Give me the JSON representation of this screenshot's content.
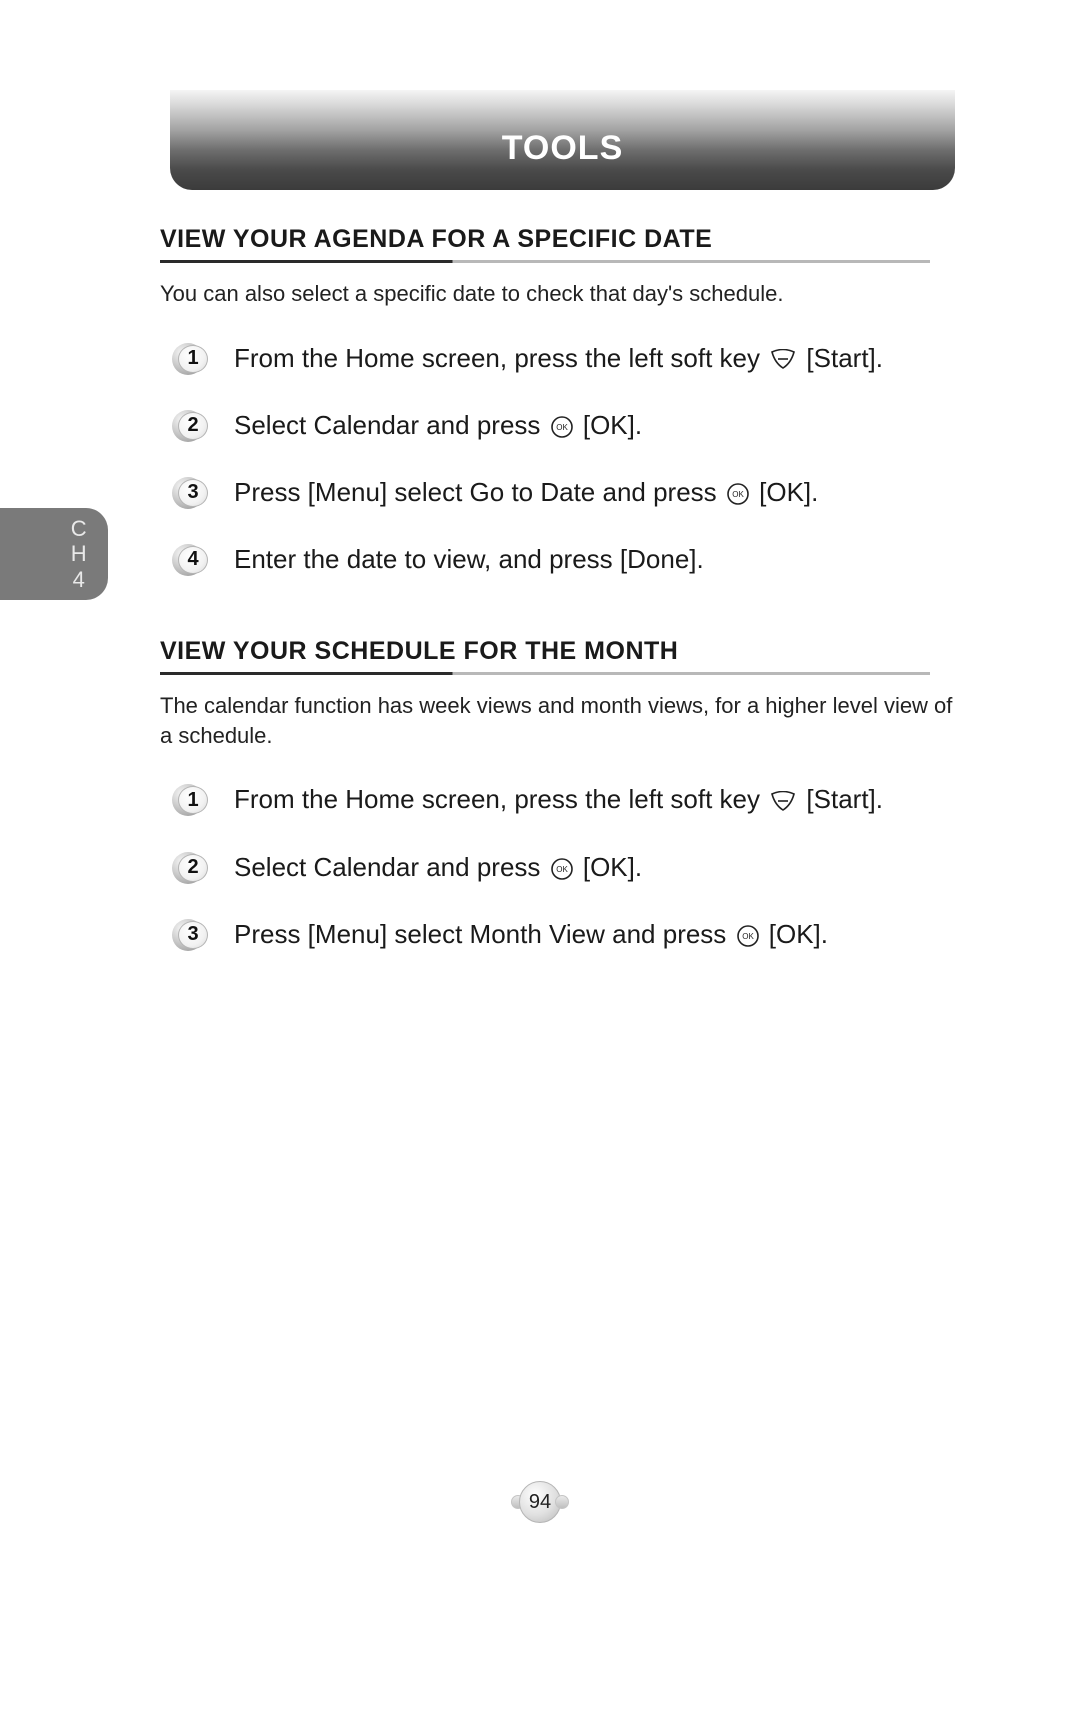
{
  "header": {
    "title": "TOOLS"
  },
  "chapter_tab": {
    "line1": "C",
    "line2": "H",
    "line3": "4"
  },
  "sections": [
    {
      "heading": "VIEW YOUR AGENDA FOR A SPECIFIC DATE",
      "intro": "You can also select a specific date to check that day's schedule.",
      "steps": [
        {
          "num": "1",
          "pre": "From the Home screen, press the left soft key ",
          "icon": "softkey",
          "post": " [Start]."
        },
        {
          "num": "2",
          "pre": "Select Calendar and press ",
          "icon": "ok",
          "post": " [OK]."
        },
        {
          "num": "3",
          "pre": "Press [Menu] select Go to Date and press ",
          "icon": "ok",
          "post": " [OK]."
        },
        {
          "num": "4",
          "pre": "Enter the date to view, and press [Done].",
          "icon": null,
          "post": ""
        }
      ]
    },
    {
      "heading": "VIEW YOUR SCHEDULE FOR THE MONTH",
      "intro": "The calendar function has week views and month views, for a higher level view of a schedule.",
      "steps": [
        {
          "num": "1",
          "pre": "From the Home screen, press the left soft key ",
          "icon": "softkey",
          "post": " [Start]."
        },
        {
          "num": "2",
          "pre": "Select Calendar and press ",
          "icon": "ok",
          "post": " [OK]."
        },
        {
          "num": "3",
          "pre": "Press [Menu] select Month View and press ",
          "icon": "ok",
          "post": " [OK]."
        }
      ]
    }
  ],
  "page_number": "94"
}
